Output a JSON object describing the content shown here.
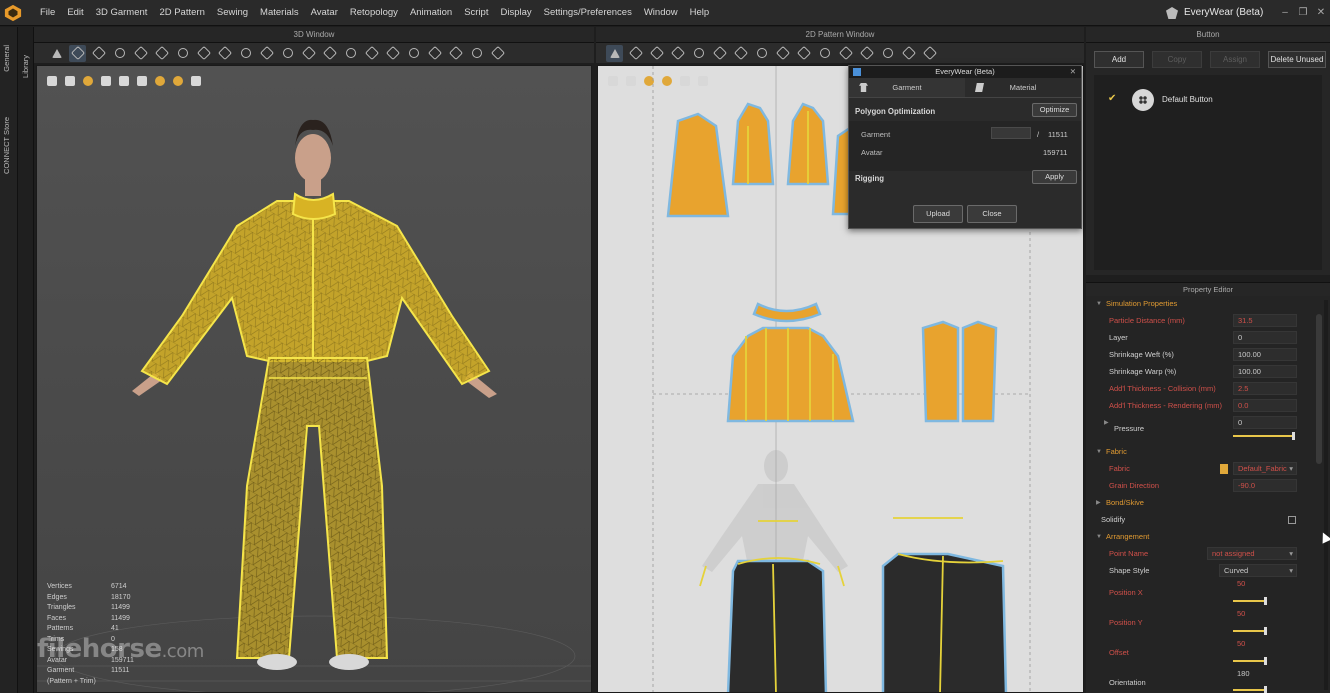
{
  "menu": [
    "File",
    "Edit",
    "3D Garment",
    "2D Pattern",
    "Sewing",
    "Materials",
    "Avatar",
    "Retopology",
    "Animation",
    "Script",
    "Display",
    "Settings/Preferences",
    "Window",
    "Help"
  ],
  "app_title": "EveryWear (Beta)",
  "left_tabs": {
    "library": "Library",
    "general": "General",
    "connect": "CONNECT Store"
  },
  "window3d": {
    "title": "3D Window",
    "stats": [
      {
        "label": "Vertices",
        "value": "6714"
      },
      {
        "label": "Edges",
        "value": "18170"
      },
      {
        "label": "Triangles",
        "value": "11499"
      },
      {
        "label": "Faces",
        "value": "11499"
      },
      {
        "label": "Patterns",
        "value": "41"
      },
      {
        "label": "Trims",
        "value": "0"
      },
      {
        "label": "Sewings",
        "value": "158"
      },
      {
        "label": "Avatar",
        "value": "159711"
      },
      {
        "label": "Garment",
        "value": "11511"
      },
      {
        "label": "(Pattern + Trim)",
        "value": ""
      }
    ],
    "watermark": "filehorse",
    "watermark_suffix": ".com"
  },
  "window2d": {
    "title": "2D Pattern Window"
  },
  "plugin": {
    "title": "EveryWear (Beta)",
    "tab_garment": "Garment",
    "tab_material": "Material",
    "polygon_optimization": "Polygon Optimization",
    "optimize": "Optimize",
    "garment_label": "Garment",
    "garment_slash": "/",
    "garment_total": "11511",
    "avatar_label": "Avatar",
    "avatar_value": "159711",
    "rigging": "Rigging",
    "apply": "Apply",
    "upload": "Upload",
    "close": "Close"
  },
  "button_panel": {
    "title": "Button",
    "add": "Add",
    "copy": "Copy",
    "assign": "Assign",
    "delete_unused": "Delete Unused",
    "item": "Default Button"
  },
  "property_editor": {
    "title": "Property Editor",
    "simulation_properties": "Simulation Properties",
    "particle_distance": {
      "label": "Particle Distance (mm)",
      "value": "31.5"
    },
    "layer": {
      "label": "Layer",
      "value": "0"
    },
    "shrinkage_weft": {
      "label": "Shrinkage Weft (%)",
      "value": "100.00"
    },
    "shrinkage_warp": {
      "label": "Shrinkage Warp (%)",
      "value": "100.00"
    },
    "addl_collision": {
      "label": "Add'l Thickness - Collision (mm)",
      "value": "2.5"
    },
    "addl_rendering": {
      "label": "Add'l Thickness - Rendering (mm)",
      "value": "0.0"
    },
    "pressure": {
      "label": "Pressure",
      "value": "0"
    },
    "fabric_section": "Fabric",
    "fabric": {
      "label": "Fabric",
      "value": "Default_Fabric"
    },
    "grain_direction": {
      "label": "Grain Direction",
      "value": "-90.0"
    },
    "bond_skive": "Bond/Skive",
    "solidify": "Solidify",
    "arrangement": "Arrangement",
    "point_name": {
      "label": "Point Name",
      "value": "not assigned"
    },
    "shape_style": {
      "label": "Shape Style",
      "value": "Curved"
    },
    "position_x": {
      "label": "Position X",
      "value": "50"
    },
    "position_y": {
      "label": "Position Y",
      "value": "50"
    },
    "offset": {
      "label": "Offset",
      "value": "50"
    },
    "orientation": {
      "label": "Orientation",
      "value": "180"
    }
  },
  "colors": {
    "accent": "#e8c64a",
    "garment": "#e8a32e",
    "outline": "#7fb8e0",
    "warn": "#d0504a"
  }
}
